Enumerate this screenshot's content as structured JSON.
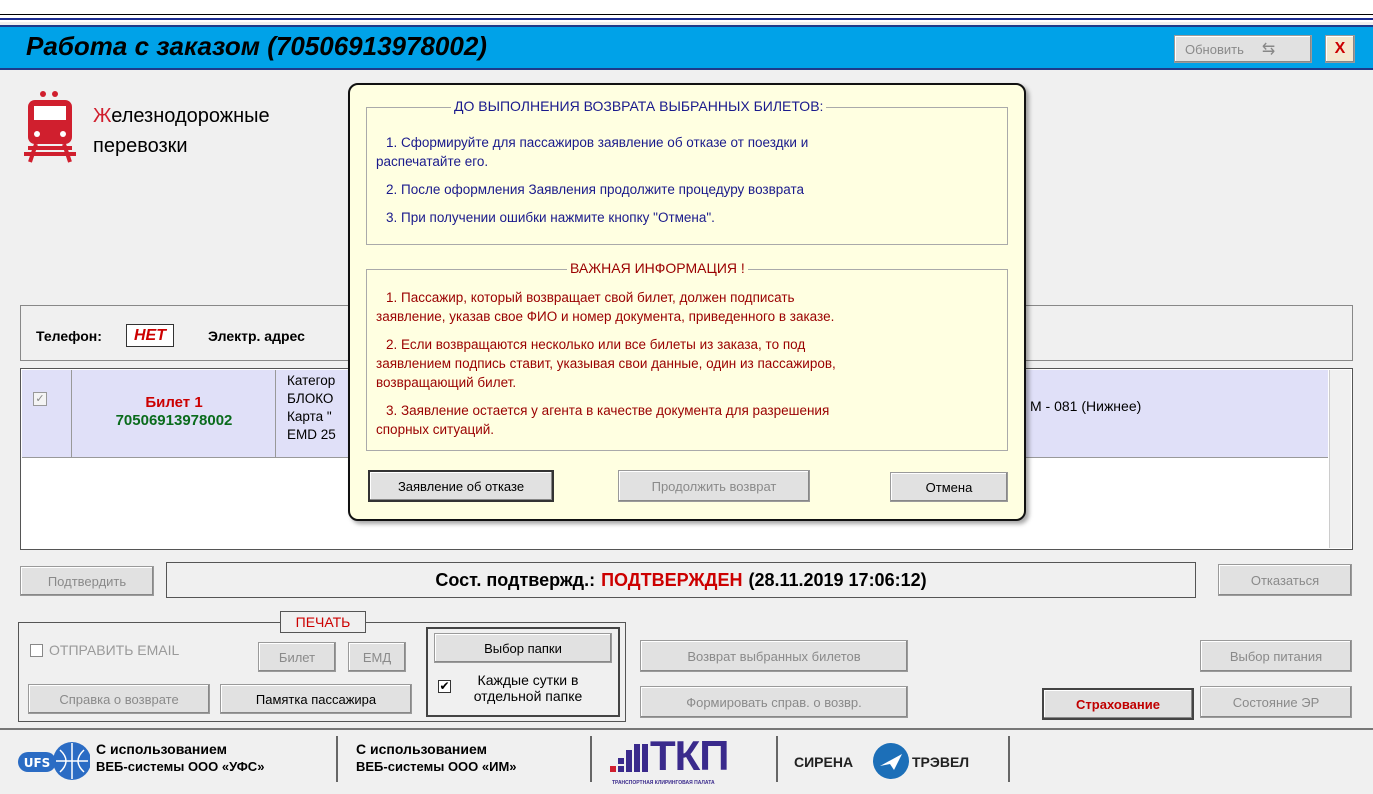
{
  "window": {
    "title": "Работа с заказом (70506913978002)",
    "refresh_label": "Обновить",
    "close_label": "X"
  },
  "logo": {
    "first_letter": "Ж",
    "line1_rest": "елезнодорожные",
    "line2": "перевозки"
  },
  "contacts": {
    "phone_label": "Телефон:",
    "phone_value": "НЕТ",
    "email_label": "Электр. адрес"
  },
  "ticket_row": {
    "ticket_label": "Билет 1",
    "ticket_number": "70506913978002",
    "details": [
      "Категор",
      "БЛОКО",
      "Карта \"",
      "EMD 25"
    ],
    "seat": "М - 081 (Нижнее)"
  },
  "confirm": {
    "button": "Подтвердить",
    "status_label": "Сост. подтвержд.:",
    "status_value": "ПОДТВЕРЖДЕН",
    "status_time": "(28.11.2019 17:06:12)",
    "refuse_button": "Отказаться",
    "status_color": "#cc0000"
  },
  "print": {
    "legend": "ПЕЧАТЬ",
    "send_email": "ОТПРАВИТЬ EMAIL",
    "ticket_button": "Билет",
    "emd_button": "ЕМД",
    "refund_cert_button": "Справка о возврате",
    "memo_button": "Памятка пассажира"
  },
  "folder": {
    "select_button": "Выбор папки",
    "daily_checkbox": "Каждые сутки в отдельной папке"
  },
  "actions": {
    "refund_selected": "Возврат выбранных билетов",
    "form_refund_cert": "Формировать справ. о возвр.",
    "insurance": "Страхование",
    "meal_choice": "Выбор питания",
    "er_status": "Состояние ЭР"
  },
  "footer": {
    "ufs_line1": "С использованием",
    "ufs_line2": "ВЕБ-системы ООО «УФС»",
    "im_line1": "С использованием",
    "im_line2": "ВЕБ-системы ООО «ИМ»",
    "tkp_logo": "ТКП",
    "tkp_sub": "ТРАНСПОРТНАЯ КЛИРИНГОВАЯ ПАЛАТА",
    "sirena_left": "СИРЕНА",
    "sirena_right": "ТРЭВЕЛ"
  },
  "dialog": {
    "before_legend": "ДО ВЫПОЛНЕНИЯ ВОЗВРАТА ВЫБРАННЫХ БИЛЕТОВ:",
    "before_items": [
      "1. Сформируйте для пассажиров заявление об отказе от поездки и",
      "распечатайте его.",
      "2. После оформления Заявления продолжите процедуру возврата",
      "3. При получении ошибки нажмите кнопку \"Отмена\"."
    ],
    "important_legend": "ВАЖНАЯ ИНФОРМАЦИЯ !",
    "important_items": [
      "1. Пассажир, который возвращает свой билет, должен подписать",
      "заявление, указав свое ФИО и номер документа, приведенного в заказе.",
      "2. Если возвращаются несколько или все билеты из заказа, то под",
      "заявлением подпись ставит, указывая свои данные, один из пассажиров,",
      "возвращающий билет.",
      "3. Заявление остается у агента в качестве  документа для разрешения",
      "спорных ситуаций."
    ],
    "statement_button": "Заявление об отказе",
    "continue_button": "Продолжить возврат",
    "cancel_button": "Отмена"
  }
}
